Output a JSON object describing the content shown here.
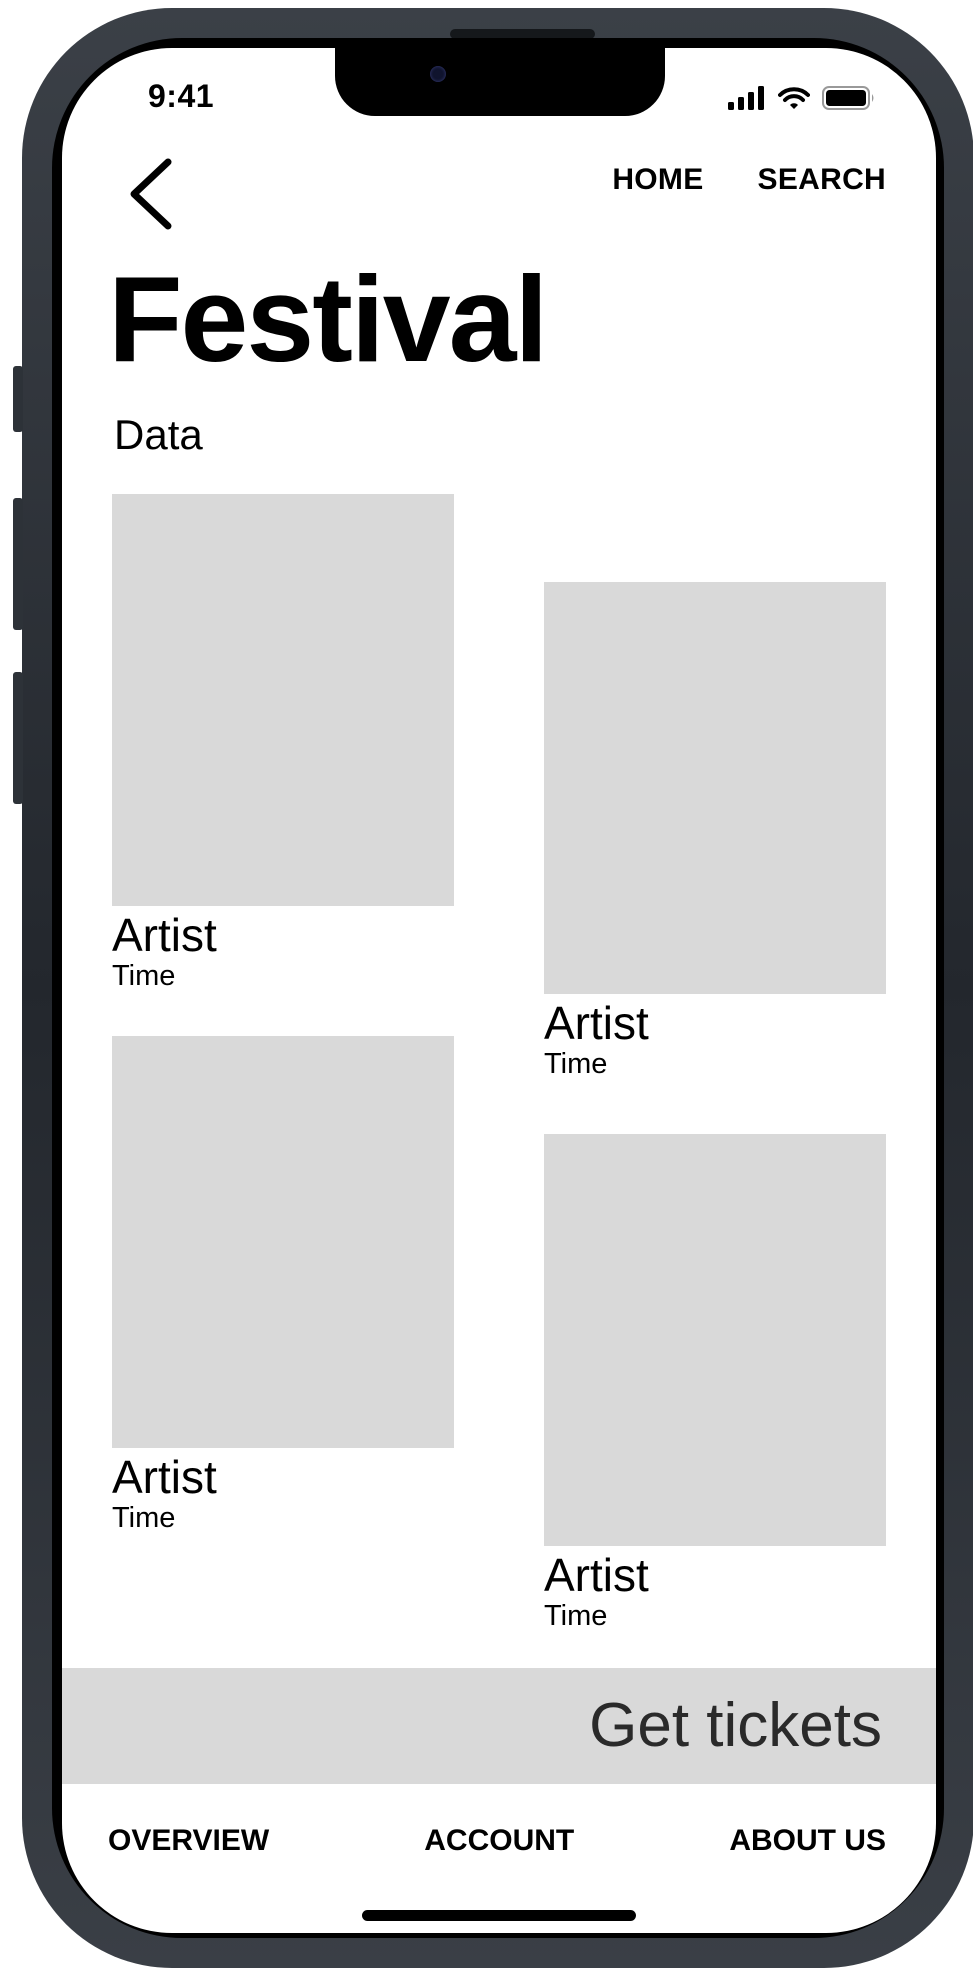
{
  "status_bar": {
    "time": "9:41",
    "icons": [
      "signal-icon",
      "wifi-icon",
      "battery-icon"
    ]
  },
  "nav": {
    "back_icon": "chevron-left-icon",
    "links": [
      "HOME",
      "SEARCH"
    ]
  },
  "header": {
    "title": "Festival",
    "subtitle": "Data"
  },
  "artists": [
    {
      "name": "Artist",
      "time": "Time"
    },
    {
      "name": "Artist",
      "time": "Time"
    },
    {
      "name": "Artist",
      "time": "Time"
    },
    {
      "name": "Artist",
      "time": "Time"
    }
  ],
  "cta": {
    "label": "Get tickets"
  },
  "bottom_nav": {
    "links": [
      "OVERVIEW",
      "ACCOUNT",
      "ABOUT US"
    ]
  },
  "colors": {
    "placeholder": "#d9d9d9",
    "text": "#000000",
    "frame": "#2b2f35"
  }
}
